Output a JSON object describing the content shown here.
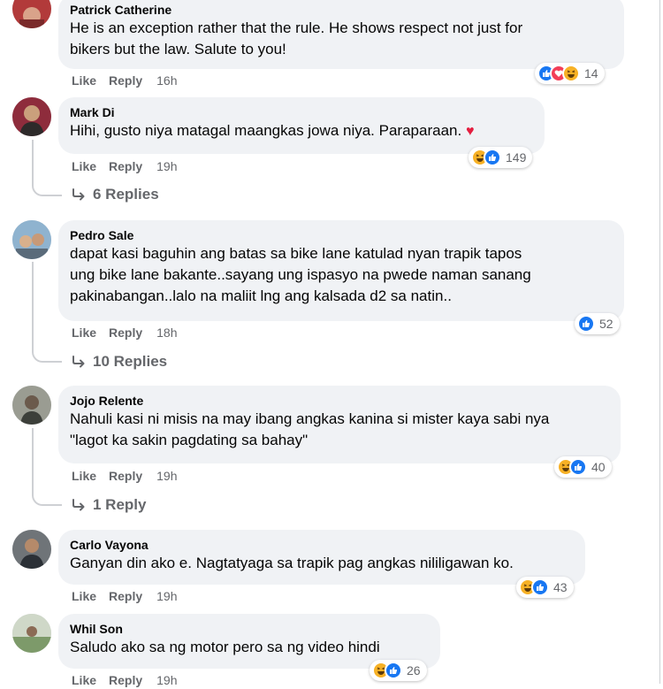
{
  "action_labels": {
    "like": "Like",
    "reply": "Reply"
  },
  "comments": [
    {
      "author": "Patrick Catherine",
      "text": "He is an exception rather that the rule. He shows respect not just for\nbikers but the law. Salute to you!",
      "time": "16h",
      "reactions": [
        "like-icon",
        "love-icon",
        "haha-icon"
      ],
      "reaction_count": "14"
    },
    {
      "author": "Mark Di",
      "text": "Hihi, gusto niya matagal maangkas jowa niya. Paraparaan.",
      "time": "19h",
      "reactions": [
        "haha-icon",
        "like-icon"
      ],
      "reaction_count": "149",
      "replies": "6 Replies"
    },
    {
      "author": "Pedro Sale",
      "text": "dapat kasi baguhin ang batas sa bike lane katulad nyan trapik tapos\nung bike lane bakante..sayang ung ispasyo na pwede naman sanang\npakinabangan..lalo na maliit lng ang kalsada d2 sa natin..",
      "time": "18h",
      "reactions": [
        "like-icon"
      ],
      "reaction_count": "52",
      "replies": "10 Replies"
    },
    {
      "author": "Jojo Relente",
      "text": "Nahuli kasi ni misis na may ibang angkas kanina si mister kaya sabi nya\n\"lagot ka sakin pagdating sa bahay\"",
      "time": "19h",
      "reactions": [
        "haha-icon",
        "like-icon"
      ],
      "reaction_count": "40",
      "replies": "1 Reply"
    },
    {
      "author": "Carlo Vayona",
      "text": "Ganyan din ako e. Nagtatyaga sa trapik pag angkas nililigawan ko.",
      "time": "19h",
      "reactions": [
        "haha-icon",
        "like-icon"
      ],
      "reaction_count": "43"
    },
    {
      "author": "Whil Son",
      "text": "Saludo ako sa ng motor pero sa ng video hindi",
      "time": "19h",
      "reactions": [
        "haha-icon",
        "like-icon"
      ],
      "reaction_count": "26"
    }
  ],
  "colors": {
    "bubble": "#f0f2f5",
    "meta_text": "#65676b",
    "like_blue": "#1877f2",
    "haha_yellow": "#f7b125",
    "love_red": "#f33e58"
  }
}
